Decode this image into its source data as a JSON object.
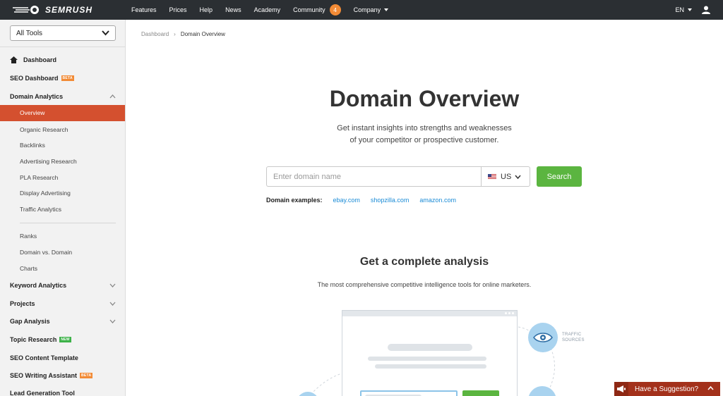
{
  "brand": {
    "name": "SEMRUSH"
  },
  "nav": {
    "items": [
      {
        "label": "Features"
      },
      {
        "label": "Prices"
      },
      {
        "label": "Help"
      },
      {
        "label": "News"
      },
      {
        "label": "Academy"
      },
      {
        "label": "Community",
        "badge": "4"
      },
      {
        "label": "Company"
      }
    ],
    "language": "EN"
  },
  "sidebar": {
    "tools_select": "All Tools",
    "items": {
      "dashboard": "Dashboard",
      "seo_dashboard": "SEO Dashboard",
      "domain_analytics": "Domain Analytics",
      "overview": "Overview",
      "organic_research": "Organic Research",
      "backlinks": "Backlinks",
      "advertising_research": "Advertising Research",
      "pla_research": "PLA Research",
      "display_advertising": "Display Advertising",
      "traffic_analytics": "Traffic Analytics",
      "ranks": "Ranks",
      "domain_vs_domain": "Domain vs. Domain",
      "charts": "Charts",
      "keyword_analytics": "Keyword Analytics",
      "projects": "Projects",
      "gap_analysis": "Gap Analysis",
      "topic_research": "Topic Research",
      "seo_content_template": "SEO Content Template",
      "seo_writing_assistant": "SEO Writing Assistant",
      "lead_generation_tool": "Lead Generation Tool"
    },
    "tags": {
      "beta": "BETA",
      "new": "NEW"
    }
  },
  "breadcrumb": {
    "root": "Dashboard",
    "current": "Domain Overview"
  },
  "main": {
    "title": "Domain Overview",
    "subtitle_line1": "Get instant insights into strengths and weaknesses",
    "subtitle_line2": "of your competitor or prospective customer.",
    "search": {
      "placeholder": "Enter domain name",
      "country": "US",
      "button": "Search"
    },
    "examples": {
      "label": "Domain examples:",
      "links": [
        "ebay.com",
        "shopzilla.com",
        "amazon.com"
      ]
    },
    "section_title": "Get a complete analysis",
    "section_subtitle": "The most comprehensive competitive intelligence tools for online marketers.",
    "illustration": {
      "traffic_line1": "TRAFFIC",
      "traffic_line2": "SOURCES"
    }
  },
  "suggestion": {
    "label": "Have a Suggestion?"
  },
  "colors": {
    "nav_bg": "#2b2f33",
    "active": "#d4502f",
    "accent_green": "#5bb540",
    "link": "#1a8bd6",
    "badge": "#f28b36"
  }
}
